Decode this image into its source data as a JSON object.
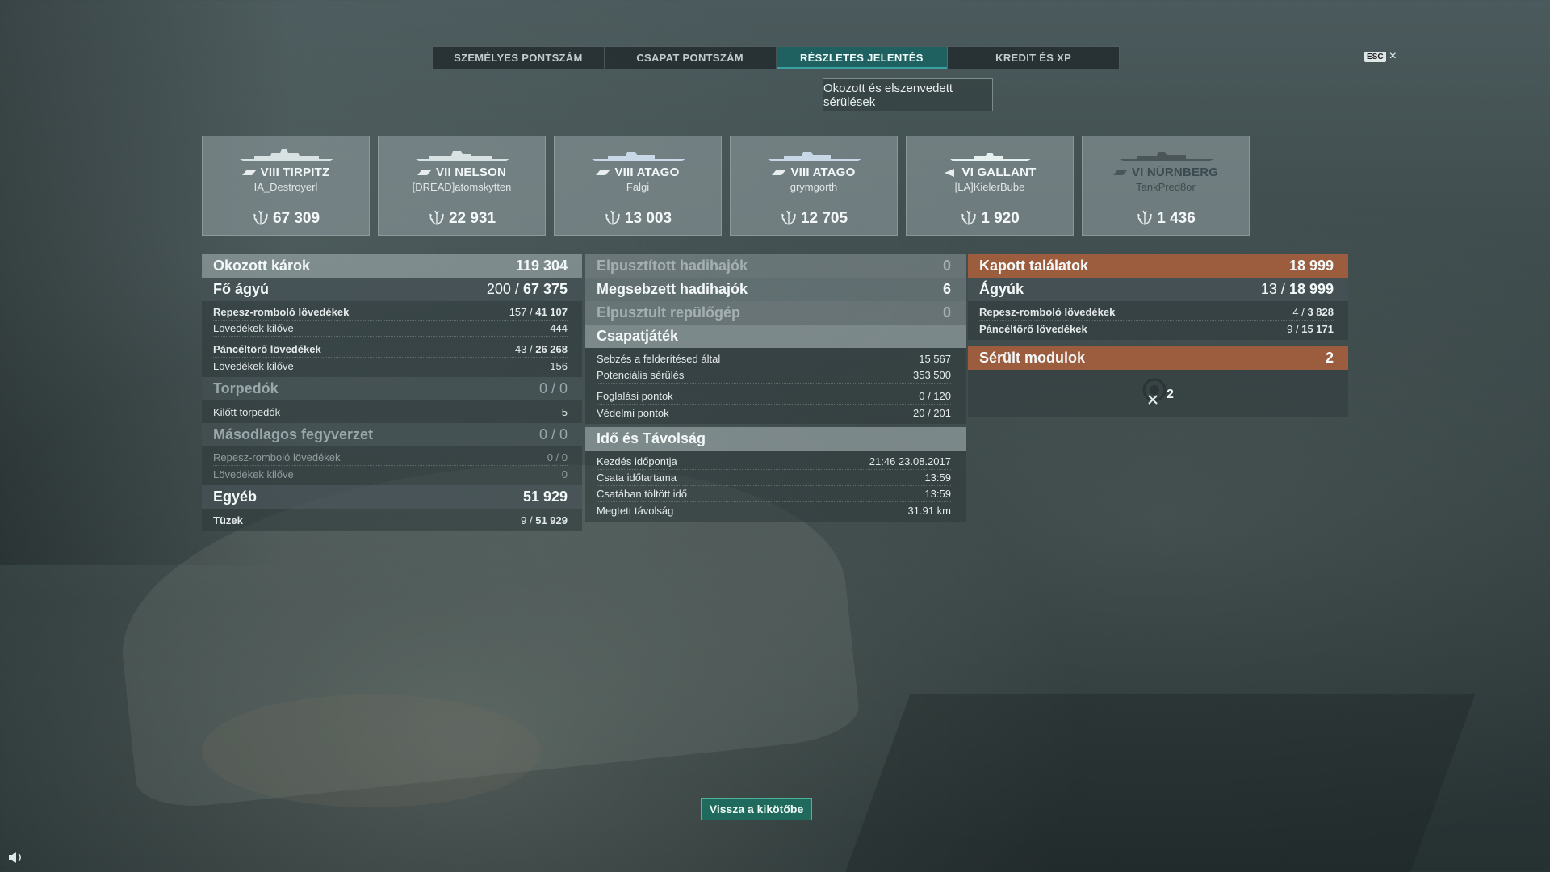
{
  "tabs": [
    {
      "label": "SZEMÉLYES PONTSZÁM",
      "active": false
    },
    {
      "label": "CSAPAT PONTSZÁM",
      "active": false
    },
    {
      "label": "RÉSZLETES JELENTÉS",
      "active": true
    },
    {
      "label": "KREDIT ÉS XP",
      "active": false
    }
  ],
  "esc": {
    "key": "ESC",
    "close": "×"
  },
  "subtab": "Okozott és elszenvedett sérülések",
  "ships": [
    {
      "tier": "VIII",
      "name": "TIRPITZ",
      "player": "IA_Destroyerl",
      "damage": "67 309",
      "class_icon": "battleship-icon"
    },
    {
      "tier": "VII",
      "name": "NELSON",
      "player": "[DREAD]atomskytten",
      "damage": "22 931",
      "class_icon": "battleship-icon"
    },
    {
      "tier": "VIII",
      "name": "ATAGO",
      "player": "Falgi",
      "damage": "13 003",
      "class_icon": "cruiser-icon"
    },
    {
      "tier": "VIII",
      "name": "ATAGO",
      "player": "grymgorth",
      "damage": "12 705",
      "class_icon": "cruiser-icon"
    },
    {
      "tier": "VI",
      "name": "GALLANT",
      "player": "[LA]KielerBube",
      "damage": "1 920",
      "class_icon": "destroyer-icon"
    },
    {
      "tier": "VI",
      "name": "NÜRNBERG",
      "player": "TankPred8or",
      "damage": "1 436",
      "class_icon": "cruiser-icon"
    }
  ],
  "left": {
    "dealt": {
      "label": "Okozott károk",
      "value": "119 304"
    },
    "main": {
      "label": "Fő ágyú",
      "pre": "200 / ",
      "value": "67 375"
    },
    "he": {
      "label": "Repesz-romboló lövedékek",
      "pre": "157 / ",
      "value": "41 107"
    },
    "he_fired": {
      "label": "Lövedékek kilőve",
      "value": "444"
    },
    "ap": {
      "label": "Páncéltörő lövedékek",
      "pre": "43 / ",
      "value": "26 268"
    },
    "ap_fired": {
      "label": "Lövedékek kilőve",
      "value": "156"
    },
    "torpedo": {
      "label": "Torpedók",
      "value": "0 / 0"
    },
    "torpedo_fired": {
      "label": "Kilőtt torpedók",
      "value": "5"
    },
    "secondary": {
      "label": "Másodlagos fegyverzet",
      "value": "0 / 0"
    },
    "sec_he": {
      "label": "Repesz-romboló lövedékek",
      "value": "0 / 0"
    },
    "sec_fired": {
      "label": "Lövedékek kilőve",
      "value": "0"
    },
    "other": {
      "label": "Egyéb",
      "value": "51 929"
    },
    "fires": {
      "label": "Tüzek",
      "pre": "9 / ",
      "value": "51 929"
    }
  },
  "mid": {
    "destroyed": {
      "label": "Elpusztított hadihajók",
      "value": "0"
    },
    "damaged": {
      "label": "Megsebzett hadihajók",
      "value": "6"
    },
    "planes": {
      "label": "Elpusztult repülőgép",
      "value": "0"
    },
    "team": {
      "label": "Csapatjáték"
    },
    "spotting": {
      "label": "Sebzés a felderítésed által",
      "value": "15 567"
    },
    "potential": {
      "label": "Potenciális sérülés",
      "value": "353 500"
    },
    "capture": {
      "label": "Foglalási pontok",
      "value": "0 / 120"
    },
    "defense": {
      "label": "Védelmi pontok",
      "value": "20 / 201"
    },
    "time": {
      "label": "Idő és Távolság"
    },
    "start": {
      "label": "Kezdés időpontja",
      "value": "21:46  23.08.2017"
    },
    "duration": {
      "label": "Csata időtartama",
      "value": "13:59"
    },
    "in_battle": {
      "label": "Csatában töltött idő",
      "value": "13:59"
    },
    "distance": {
      "label": "Megtett távolság",
      "value": "31.91 km"
    }
  },
  "right": {
    "received": {
      "label": "Kapott találatok",
      "value": "18 999"
    },
    "guns": {
      "label": "Ágyúk",
      "pre": "13 / ",
      "value": "18 999"
    },
    "he": {
      "label": "Repesz-romboló lövedékek",
      "pre": "4 / ",
      "value": "3 828"
    },
    "ap": {
      "label": "Páncéltörő lövedékek",
      "pre": "9 / ",
      "value": "15 171"
    },
    "modules": {
      "label": "Sérült modulok",
      "value": "2"
    },
    "module_count": "2"
  },
  "back_button": "Vissza a kikötőbe",
  "colors": {
    "accent": "#1f6060",
    "orange": "#a8603c",
    "button": "#1f6a5c"
  }
}
